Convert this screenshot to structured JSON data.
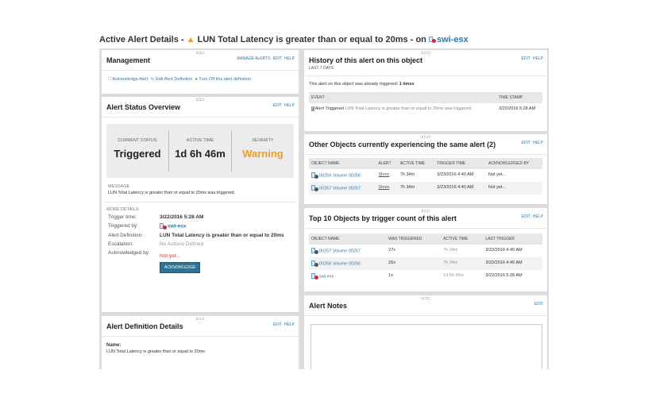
{
  "title": {
    "prefix": "Active Alert Details - ",
    "warning_icon": "warning-triangle-icon",
    "alert_name": "LUN Total Latency is greater than or equal to 20ms",
    "on": " - on ",
    "node": "swi-esx"
  },
  "management": {
    "title": "Management",
    "links": [
      "MANAGE ALERTS",
      "EDIT",
      "HELP"
    ],
    "actions": [
      "Acknowledge Alert",
      "Edit Alert Definition",
      "Turn Off this alert definition"
    ]
  },
  "status": {
    "title": "Alert Status Overview",
    "links": [
      "EDIT",
      "HELP"
    ],
    "current_status_label": "CURRENT STATUS",
    "current_status": "Triggered",
    "active_time_label": "ACTIVE TIME",
    "active_time": "1d 6h 46m",
    "severity_label": "SEVERITY",
    "severity": "Warning",
    "message_label": "MESSAGE",
    "message": "LUN Total Latency is greater than or equal to 20ms was triggered.",
    "more_label": "MORE DETAILS",
    "trigger_time_label": "Trigger time:",
    "trigger_time": "3/22/2016 5:28 AM",
    "triggered_by_label": "Triggered by:",
    "triggered_by": "swi-esx",
    "definition_label": "Alert Definition:",
    "definition": "LUN Total Latency is greater than or equal to 20ms",
    "escalation_label": "Escalation:",
    "escalation": "No Actions Defined",
    "ack_label": "Acknowledged by:",
    "ack": "Not yet...",
    "ack_button": "ACKNOWLEDGE"
  },
  "definition": {
    "title": "Alert Definition Details",
    "links": [
      "EDIT",
      "HELP"
    ],
    "name_label": "Name:",
    "name": "LUN Total Latency is greater than or equal to 20ms"
  },
  "history": {
    "title": "History of this alert on this object",
    "subtitle": "LAST 7 DAYS",
    "links": [
      "EDIT",
      "HELP"
    ],
    "summary": "This alert on this object was already triggered: ",
    "count": "1 times",
    "columns": [
      "EVENT",
      "TIME STAMP"
    ],
    "event_type": "Alert Triggered",
    "event_text": "LUN Total Latency is greater than or equal to 20ms was triggered.",
    "timestamp": "3/22/2016 5:28 AM"
  },
  "others": {
    "title": "Other Objects currently experiencing the same alert (2)",
    "links": [
      "EDIT",
      "HELP"
    ],
    "columns": [
      "OBJECT NAME",
      "ALERT",
      "ACTIVE TIME",
      "TRIGGER TIME",
      "ACKNOWLEDGED BY"
    ],
    "rows": [
      {
        "name": "00256 Volume 00256",
        "alert": "Show",
        "active": "7h 34m",
        "trigger": "3/23/2016 4:40 AM",
        "ack": "Not yet..."
      },
      {
        "name": "00257 Volume 00257",
        "alert": "Show",
        "active": "7h 34m",
        "trigger": "3/23/2016 4:40 AM",
        "ack": "Not yet..."
      }
    ]
  },
  "top10": {
    "title": "Top 10 Objects by trigger count of this alert",
    "links": [
      "EDIT",
      "HELP"
    ],
    "columns": [
      "OBJECT NAME",
      "WAS TRIGGERED",
      "ACTIVE TIME",
      "LAST TRIGGER"
    ],
    "rows": [
      {
        "name": "00257 Volume 00257",
        "count": "27x",
        "active": "7h 34m",
        "last": "3/23/2016 4:40 AM"
      },
      {
        "name": "00256 Volume 00256",
        "count": "26x",
        "active": "7h 34m",
        "last": "3/23/2016 4:40 AM"
      },
      {
        "name": "swi-esx",
        "count": "1x",
        "active": "1d 6h 46m",
        "last": "3/22/2016 5:28 AM"
      }
    ]
  },
  "notes": {
    "title": "Alert Notes",
    "links": [
      "EDIT"
    ],
    "text": ""
  }
}
